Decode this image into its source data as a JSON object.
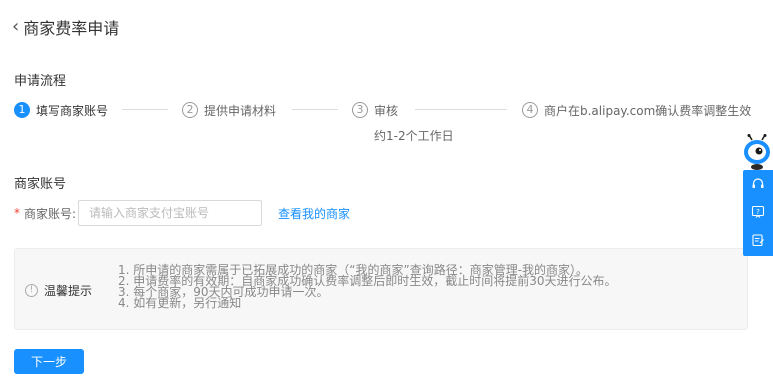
{
  "header": {
    "title": "商家费率申请"
  },
  "process": {
    "title": "申请流程",
    "steps": [
      {
        "num": "1",
        "label": "填写商家账号"
      },
      {
        "num": "2",
        "label": "提供申请材料"
      },
      {
        "num": "3",
        "label": "审核"
      },
      {
        "num": "4",
        "label": "商户在b.alipay.com确认费率调整生效"
      }
    ],
    "review_note": "约1-2个工作日",
    "active_step": 1
  },
  "account": {
    "section_title": "商家账号",
    "required_mark": "*",
    "label": "商家账号:",
    "placeholder": "请输入商家支付宝账号",
    "value": "",
    "link": "查看我的商家"
  },
  "notice": {
    "icon_glyph": "!",
    "title": "温馨提示",
    "lines": [
      "1. 所申请的商家需属于已拓展成功的商家（“我的商家”查询路径：商家管理-我的商家）。",
      "2. 申请费率的有效期：自商家成功确认费率调整后即时生效，截止时间将提前30天进行公布。",
      "3. 每个商家，90天内可成功申请一次。",
      "4. 如有更新，另行通知"
    ]
  },
  "actions": {
    "next": "下一步"
  },
  "floating": {
    "buttons": [
      "headset-icon",
      "help-icon",
      "feedback-icon"
    ]
  },
  "colors": {
    "primary": "#1890ff",
    "required": "#f04134"
  }
}
